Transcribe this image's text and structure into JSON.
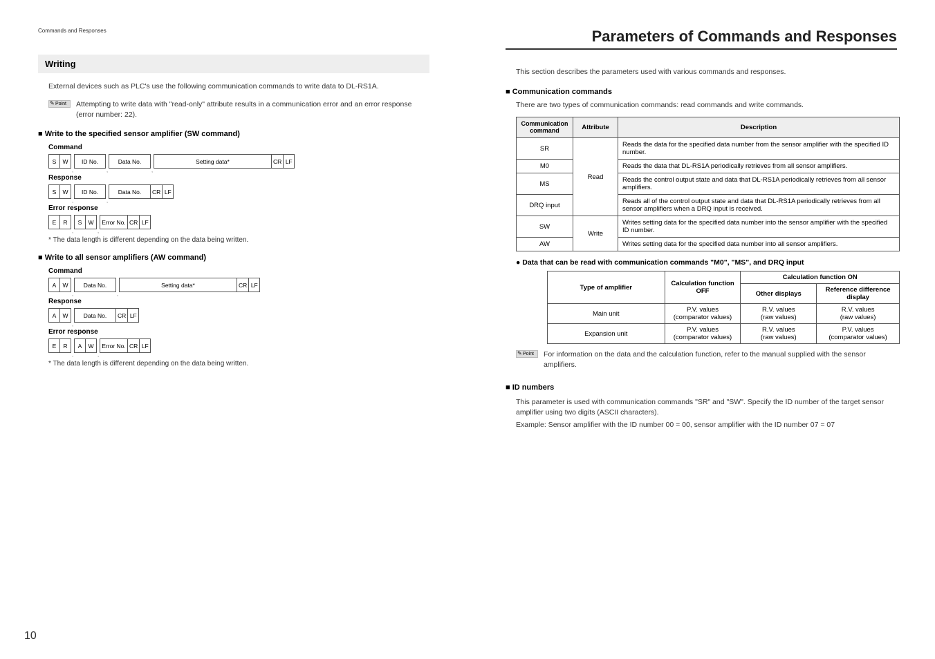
{
  "left": {
    "headerSmall": "Commands and Responses",
    "writing": {
      "title": "Writing",
      "intro": "External devices such as PLC's use the following communication commands to write data to DL-RS1A.",
      "pointLabel": "Point",
      "pointText": "Attempting to write data with \"read-only\" attribute results in a communication error and an error response (error number: 22)."
    },
    "sw": {
      "title": "■ Write to the specified sensor amplifier (SW command)",
      "commandLabel": "Command",
      "responseLabel": "Response",
      "errorLabel": "Error response",
      "cells": {
        "S": "S",
        "W": "W",
        "ID": "ID No.",
        "DATA": "Data No.",
        "SETTING": "Setting data*",
        "CR": "CR",
        "LF": "LF",
        "E": "E",
        "R": "R",
        "ERR": "Error No."
      },
      "foot": "*  The data length is different depending on the data being written."
    },
    "aw": {
      "title": "■ Write to all sensor amplifiers (AW command)",
      "commandLabel": "Command",
      "responseLabel": "Response",
      "errorLabel": "Error response",
      "cells": {
        "A": "A",
        "W": "W",
        "DATA": "Data No.",
        "SETTING": "Setting data*",
        "CR": "CR",
        "LF": "LF",
        "E": "E",
        "R": "R",
        "ERR": "Error No."
      },
      "foot": "*  The data length is different depending on the data being written."
    },
    "pageNumber": "10"
  },
  "right": {
    "pageTitle": "Parameters of Commands and Responses",
    "intro": "This section describes the parameters used with various commands and responses.",
    "comm": {
      "title": "■ Communication commands",
      "intro": "There are two types of communication commands: read commands and write commands.",
      "headers": {
        "cmd": "Communication command",
        "attr": "Attribute",
        "desc": "Description"
      },
      "rows": {
        "sr": {
          "cmd": "SR",
          "desc": "Reads the data for the specified data number from the sensor amplifier with the specified ID number."
        },
        "m0": {
          "cmd": "M0",
          "desc": "Reads the data that DL-RS1A periodically retrieves from all sensor amplifiers."
        },
        "ms": {
          "cmd": "MS",
          "desc": "Reads the control output state and data that DL-RS1A periodically retrieves from all sensor amplifiers."
        },
        "drq": {
          "cmd": "DRQ input",
          "desc": "Reads all of the control output state and data that DL-RS1A periodically retrieves from all sensor amplifiers when a DRQ input is received."
        },
        "sw": {
          "cmd": "SW",
          "desc": "Writes setting data for the specified data number into the sensor amplifier with the specified ID number."
        },
        "aw2": {
          "cmd": "AW",
          "desc": "Writes setting data for the specified data number into all sensor amplifiers."
        }
      },
      "attrs": {
        "read": "Read",
        "write": "Write"
      }
    },
    "dataRead": {
      "title": "● Data that can be read with communication commands \"M0\", \"MS\", and DRQ input",
      "headers": {
        "type": "Type of amplifier",
        "calcOff": "Calculation function OFF",
        "calcOn": "Calculation function ON",
        "other": "Other displays",
        "ref": "Reference difference display"
      },
      "rows": {
        "main": {
          "type": "Main unit",
          "off1": "P.V. values",
          "off2": "(comparator values)",
          "other1": "R.V. values",
          "other2": "(raw values)",
          "ref1": "R.V. values",
          "ref2": "(raw values)"
        },
        "exp": {
          "type": "Expansion unit",
          "off1": "P.V. values",
          "off2": "(comparator values)",
          "other1": "R.V. values",
          "other2": "(raw values)",
          "ref1": "P.V. values",
          "ref2": "(comparator values)"
        }
      },
      "pointLabel": "Point",
      "pointText": "For information on the data and the calculation function, refer to the manual supplied with the sensor amplifiers."
    },
    "id": {
      "title": "■ ID numbers",
      "p1": "This parameter is used with communication commands \"SR\" and \"SW\". Specify the ID number of the target sensor amplifier using two digits (ASCII characters).",
      "p2": "Example: Sensor amplifier with the ID number 00 = 00, sensor amplifier with the ID number 07 = 07"
    }
  }
}
